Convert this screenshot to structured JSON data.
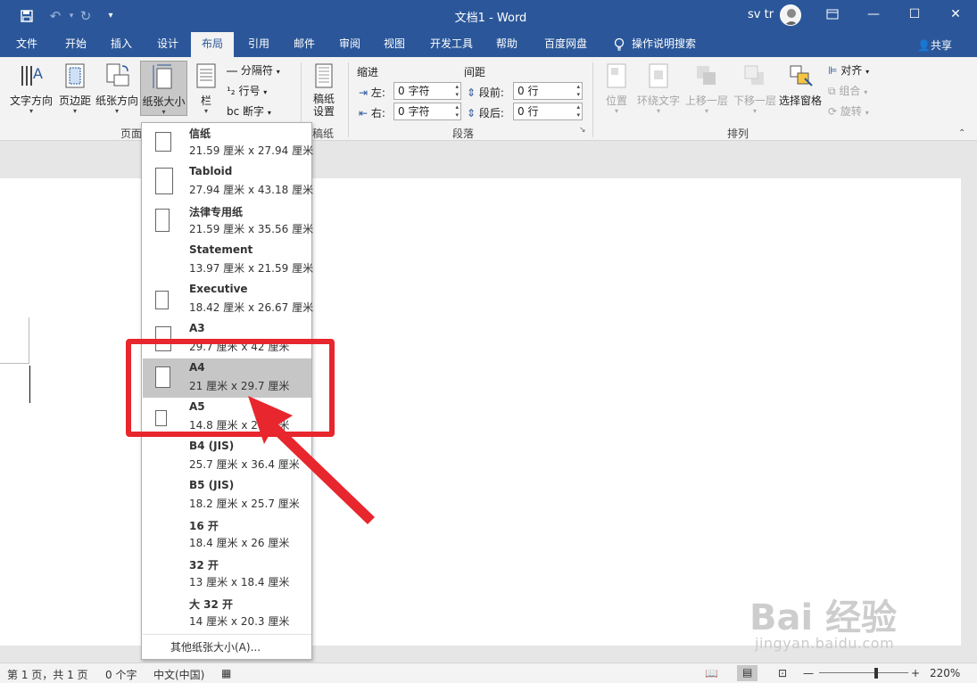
{
  "app": {
    "doc_title": "文档1 - Word",
    "user": "sv tr"
  },
  "tabs": [
    "文件",
    "开始",
    "插入",
    "设计",
    "布局",
    "引用",
    "邮件",
    "审阅",
    "视图",
    "开发工具",
    "帮助",
    "百度网盘",
    "操作说明搜索"
  ],
  "active_tab": "布局",
  "share": "共享",
  "ribbon": {
    "page_setup": {
      "text_direction": "文字方向",
      "margins": "页边距",
      "orientation": "纸张方向",
      "size": "纸张大小",
      "columns": "栏",
      "breaks": "分隔符",
      "line_numbers": "行号",
      "hyphenation": "断字",
      "group_label": "页面"
    },
    "draft": {
      "label": "稿纸设置",
      "group_label": "稿纸"
    },
    "paragraph": {
      "indent_label": "缩进",
      "spacing_label": "间距",
      "left_label": "左:",
      "right_label": "右:",
      "left_value": "0 字符",
      "right_value": "0 字符",
      "before_label": "段前:",
      "after_label": "段后:",
      "before_value": "0 行",
      "after_value": "0 行",
      "group_label": "段落"
    },
    "arrange": {
      "position": "位置",
      "wrap": "环绕文字",
      "forward": "上移一层",
      "backward": "下移一层",
      "selection_pane": "选择窗格",
      "align": "对齐",
      "group": "组合",
      "rotate": "旋转",
      "group_label": "排列"
    }
  },
  "dropdown": {
    "options": [
      {
        "name": "信纸",
        "dims": "21.59 厘米 x 27.94 厘米"
      },
      {
        "name": "Tabloid",
        "dims": "27.94 厘米 x 43.18 厘米"
      },
      {
        "name": "法律专用纸",
        "dims": "21.59 厘米 x 35.56 厘米"
      },
      {
        "name": "Statement",
        "dims": "13.97 厘米 x 21.59 厘米"
      },
      {
        "name": "Executive",
        "dims": "18.42 厘米 x 26.67 厘米"
      },
      {
        "name": "A3",
        "dims": "29.7 厘米 x 42 厘米"
      },
      {
        "name": "A4",
        "dims": "21 厘米 x 29.7 厘米"
      },
      {
        "name": "A5",
        "dims": "14.8 厘米 x 21 厘米"
      },
      {
        "name": "B4 (JIS)",
        "dims": "25.7 厘米 x 36.4 厘米"
      },
      {
        "name": "B5 (JIS)",
        "dims": "18.2 厘米 x 25.7 厘米"
      },
      {
        "name": "16 开",
        "dims": "18.4 厘米 x 26 厘米"
      },
      {
        "name": "32 开",
        "dims": "13 厘米 x 18.4 厘米"
      },
      {
        "name": "大 32 开",
        "dims": "14 厘米 x 20.3 厘米"
      }
    ],
    "selected": "A4",
    "more": "其他纸张大小(A)..."
  },
  "status": {
    "page": "第 1 页，共 1 页",
    "words": "0 个字",
    "language": "中文(中国)",
    "zoom": "220%"
  },
  "watermark": {
    "brand": "Bai 经验",
    "sub": "jingyan.baidu.com"
  },
  "colors": {
    "title_bar": "#2b579a",
    "highlight": "#e8262d"
  }
}
